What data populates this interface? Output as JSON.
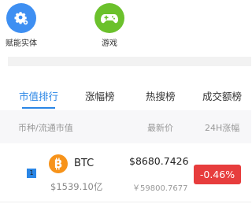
{
  "quick_links": [
    {
      "label": "赋能实体",
      "icon": "gear-icon",
      "color": "#3e8ff2"
    },
    {
      "label": "游戏",
      "icon": "gamepad-icon",
      "color": "#6bc12c"
    }
  ],
  "tabs": [
    {
      "label": "市值排行",
      "active": true
    },
    {
      "label": "涨幅榜",
      "active": false
    },
    {
      "label": "热搜榜",
      "active": false
    },
    {
      "label": "成交额榜",
      "active": false
    }
  ],
  "table_header": {
    "col1": "币种/流通市值",
    "col2": "最新价",
    "col3": "24H涨幅"
  },
  "rows": [
    {
      "rank": "1",
      "coin": "BTC",
      "icon": "bitcoin-icon",
      "market_cap": "$1539.10亿",
      "price_usd": "$8680.7426",
      "price_cny": "￥59800.7677",
      "change": "-0.46%",
      "change_color": "#e73d3d"
    }
  ],
  "colors": {
    "accent": "#2a86e6"
  }
}
